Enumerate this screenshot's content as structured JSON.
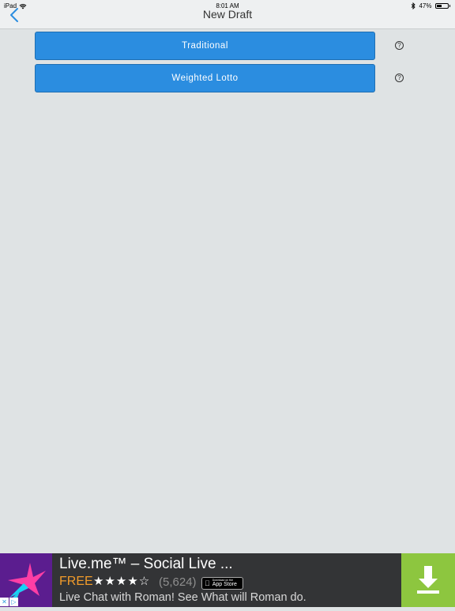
{
  "status_bar": {
    "device": "iPad",
    "time": "8:01 AM",
    "battery": "47%",
    "battery_level": 0.47
  },
  "nav": {
    "back_icon": "chevron-left-icon",
    "title": "New Draft"
  },
  "options": [
    {
      "label": "Traditional",
      "help_icon": "question-circle-icon",
      "help_glyph": "?"
    },
    {
      "label": "Weighted Lotto",
      "help_icon": "question-circle-icon",
      "help_glyph": "?"
    }
  ],
  "ad": {
    "title": "Live.me™ – Social Live ...",
    "price": "FREE",
    "stars": "★★★★☆",
    "rating_count": "(5,624)",
    "store_badge": {
      "small": "Download on the",
      "big": "App Store"
    },
    "description": "Live Chat with Roman! See What will Roman do.",
    "download_icon": "download-icon",
    "colors": {
      "logo_bg": "#5b1d8f",
      "download_bg": "#8dc63f",
      "price": "#f19b2a"
    }
  },
  "colors": {
    "accent": "#2b8de0",
    "back_chevron": "#2b8de0",
    "background": "#dfe3e4"
  }
}
